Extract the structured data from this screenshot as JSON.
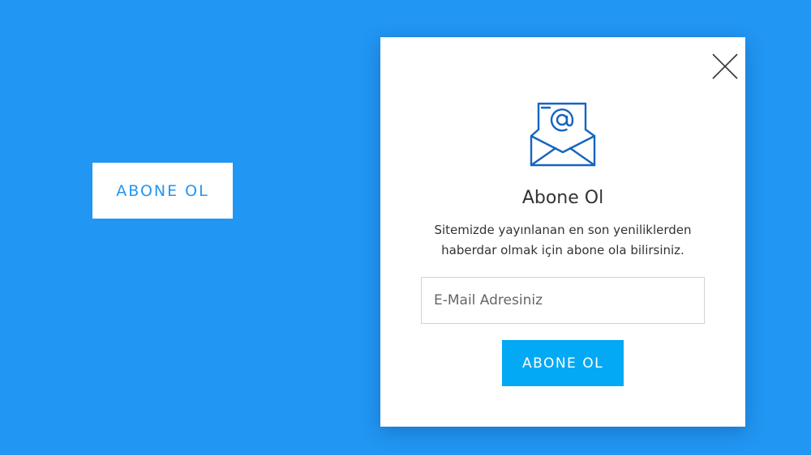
{
  "colors": {
    "background": "#2196f3",
    "accent": "#03a9f4",
    "open_button_text": "#2196f3",
    "icon_stroke": "#1565c0",
    "close_icon": "#333333"
  },
  "open_button": {
    "label": "ABONE OL"
  },
  "modal": {
    "close_icon": "close-icon",
    "envelope_icon": "open-envelope-email-icon",
    "title": "Abone Ol",
    "description": "Sitemizde yayınlanan en son yeniliklerden haberdar olmak için abone ola bilirsiniz.",
    "email_field": {
      "placeholder": "E-Mail Adresiniz",
      "value": ""
    },
    "submit_label": "ABONE OL"
  }
}
